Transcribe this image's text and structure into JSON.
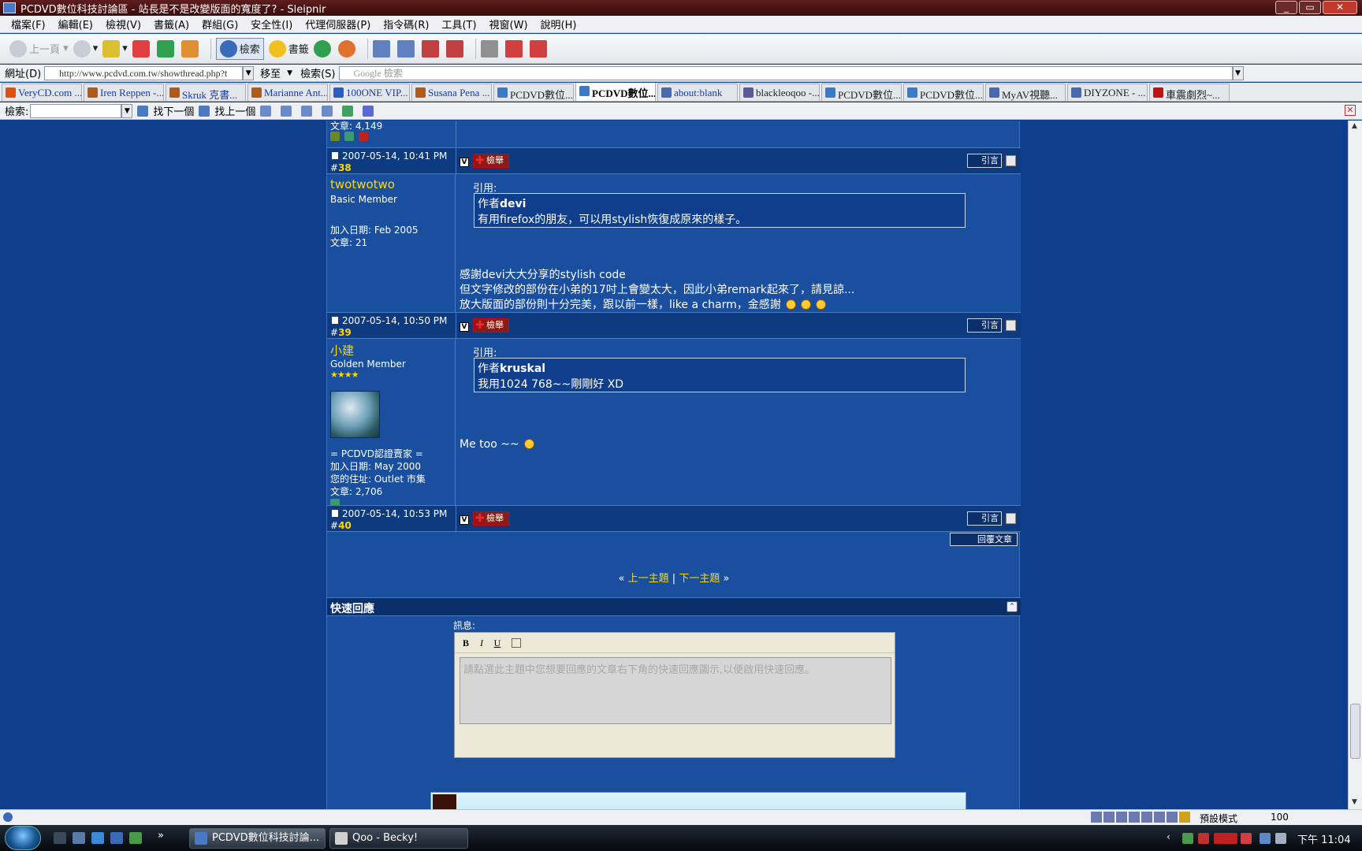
{
  "window": {
    "title": "PCDVD數位科技討論區 - 站長是不是改變版面的寬度了? - Sleipnir",
    "controls": [
      "_",
      "▭",
      "✕"
    ]
  },
  "menu": [
    "檔案(F)",
    "編輯(E)",
    "檢視(V)",
    "書籤(A)",
    "群組(G)",
    "安全性(I)",
    "代理伺服器(P)",
    "指令碼(R)",
    "工具(T)",
    "視窗(W)",
    "說明(H)"
  ],
  "toolbar": {
    "back": "上一頁",
    "search": "檢索",
    "bookmarks": "書籤"
  },
  "address": {
    "label": "網址(D)",
    "url": "http://www.pcdvd.com.tw/showthread.php?t",
    "go": "移至",
    "search_label": "檢索(S)",
    "search_placeholder": "Google 檢索"
  },
  "tabs": [
    {
      "label": "VeryCD.com ...",
      "color": "#e05010"
    },
    {
      "label": "Iren Reppen -...",
      "color": "#b05a1a"
    },
    {
      "label": "Skruk 克書...",
      "color": "#b05a1a"
    },
    {
      "label": "Marianne Ant...",
      "color": "#b05a1a"
    },
    {
      "label": "100ONE VIP...",
      "color": "#2a5ec0"
    },
    {
      "label": "Susana Pena ...",
      "color": "#b05a1a"
    },
    {
      "label": "PCDVD數位...",
      "color": "#3a7ac8"
    },
    {
      "label": "PCDVD數位...",
      "color": "#3a7ac8",
      "active": true
    },
    {
      "label": "about:blank",
      "color": "#4a6ab0"
    },
    {
      "label": "blackleoqoo -...",
      "color": "#5a5a9a"
    },
    {
      "label": "PCDVD數位...",
      "color": "#3a7ac8"
    },
    {
      "label": "PCDVD數位...",
      "color": "#3a7ac8"
    },
    {
      "label": "MyAV視聽...",
      "color": "#4a6ab0"
    },
    {
      "label": "DIYZONE - ...",
      "color": "#4a6ab0"
    },
    {
      "label": "車震劇烈~...",
      "color": "#c01010"
    }
  ],
  "findbar": {
    "label": "檢索:",
    "next": "找下一個",
    "prev": "找上一個"
  },
  "forum": {
    "prev_user_posts": "文章: 4,149",
    "posts": [
      {
        "date": "2007-05-14, 10:41 PM",
        "number": "38",
        "report": "檢舉",
        "quote_btn": "引言",
        "user": "twotwotwo",
        "user_title": "Basic Member",
        "join": "加入日期: Feb 2005",
        "count": "文章: 21",
        "quote_label": "引用:",
        "quote_author_prefix": "作者",
        "quote_author": "devi",
        "quote_text": "有用firefox的朋友，可以用stylish恢復成原來的樣子。",
        "lines": [
          "感謝devi大大分享的stylish code",
          "但文字修改的部份在小弟的17吋上會變太大，因此小弟remark起來了，請見諒...",
          "放大版面的部份則十分完美，跟以前一樣，like a charm，金感謝"
        ]
      },
      {
        "date": "2007-05-14, 10:50 PM",
        "number": "39",
        "report": "檢舉",
        "quote_btn": "引言",
        "user": "小建",
        "user_title": "Golden Member",
        "stars": "★★★★",
        "cert": "= PCDVD認證賣家 =",
        "join": "加入日期: May 2000",
        "location": "您的住址: Outlet 市集",
        "count": "文章: 2,706",
        "quote_label": "引用:",
        "quote_author_prefix": "作者",
        "quote_author": "kruskal",
        "quote_text": "我用1024 768~~剛剛好 XD",
        "lines": [
          "Me too ~~"
        ]
      },
      {
        "date": "2007-05-14, 10:53 PM",
        "number": "40",
        "report": "檢舉",
        "quote_btn": "引言"
      }
    ],
    "reply_button": "回覆文章",
    "nav": {
      "prev": "上一主題",
      "next": "下一主題",
      "sep": "|"
    },
    "quick_reply": {
      "title": "快速回應",
      "message_label": "訊息:",
      "placeholder": "請點選此主題中您想要回應的文章右下角的快速回應圖示,以便啟用快速回應。",
      "format_buttons": [
        "B",
        "I",
        "U"
      ]
    }
  },
  "statusbar": {
    "mode": "預設模式",
    "zoom": "100"
  },
  "taskbar": {
    "tasks": [
      "PCDVD數位科技討論...",
      "Qoo - Becky!"
    ],
    "clock": "下午 11:04"
  }
}
